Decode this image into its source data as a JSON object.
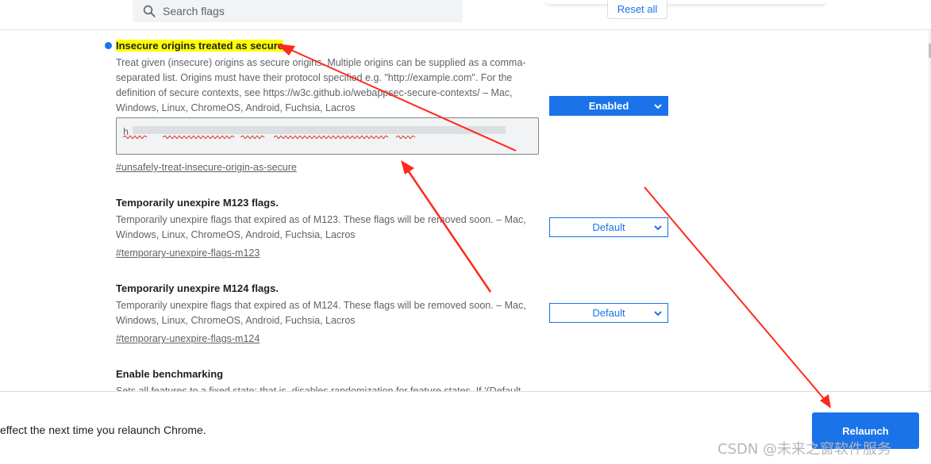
{
  "header": {
    "search_placeholder": "Search flags",
    "reset_label": "Reset all"
  },
  "experiments": [
    {
      "title": "Insecure origins treated as secure",
      "description": "Treat given (insecure) origins as secure origins. Multiple origins can be supplied as a comma-separated list. Origins must have their protocol specified e.g. \"http://example.com\". For the definition of secure contexts, see https://w3c.github.io/webappsec-secure-contexts/ – Mac, Windows, Linux, ChromeOS, Android, Fuchsia, Lacros",
      "textarea_value": "h",
      "link": "#unsafely-treat-insecure-origin-as-secure",
      "state": "Enabled",
      "modified": true
    },
    {
      "title": "Temporarily unexpire M123 flags.",
      "description": "Temporarily unexpire flags that expired as of M123. These flags will be removed soon. – Mac, Windows, Linux, ChromeOS, Android, Fuchsia, Lacros",
      "link": "#temporary-unexpire-flags-m123",
      "state": "Default"
    },
    {
      "title": "Temporarily unexpire M124 flags.",
      "description": "Temporarily unexpire flags that expired as of M124. These flags will be removed soon. – Mac, Windows, Linux, ChromeOS, Android, Fuchsia, Lacros",
      "link": "#temporary-unexpire-flags-m124",
      "state": "Default"
    },
    {
      "title": "Enable benchmarking",
      "description": "Sets all features to a fixed state; that is, disables randomization for feature states. If '(Default"
    }
  ],
  "bottom_bar": {
    "message": "effect the next time you relaunch Chrome.",
    "relaunch_label": "Relaunch"
  },
  "watermark": "CSDN @未来之窗软件服务",
  "colors": {
    "accent": "#1a73e8",
    "highlight": "#ffff00",
    "annotation_arrow": "#ff2a1a"
  },
  "icons": {
    "search": "search-icon",
    "dropdown": "chevron-down-icon",
    "modified_indicator": "modified-dot-icon"
  }
}
